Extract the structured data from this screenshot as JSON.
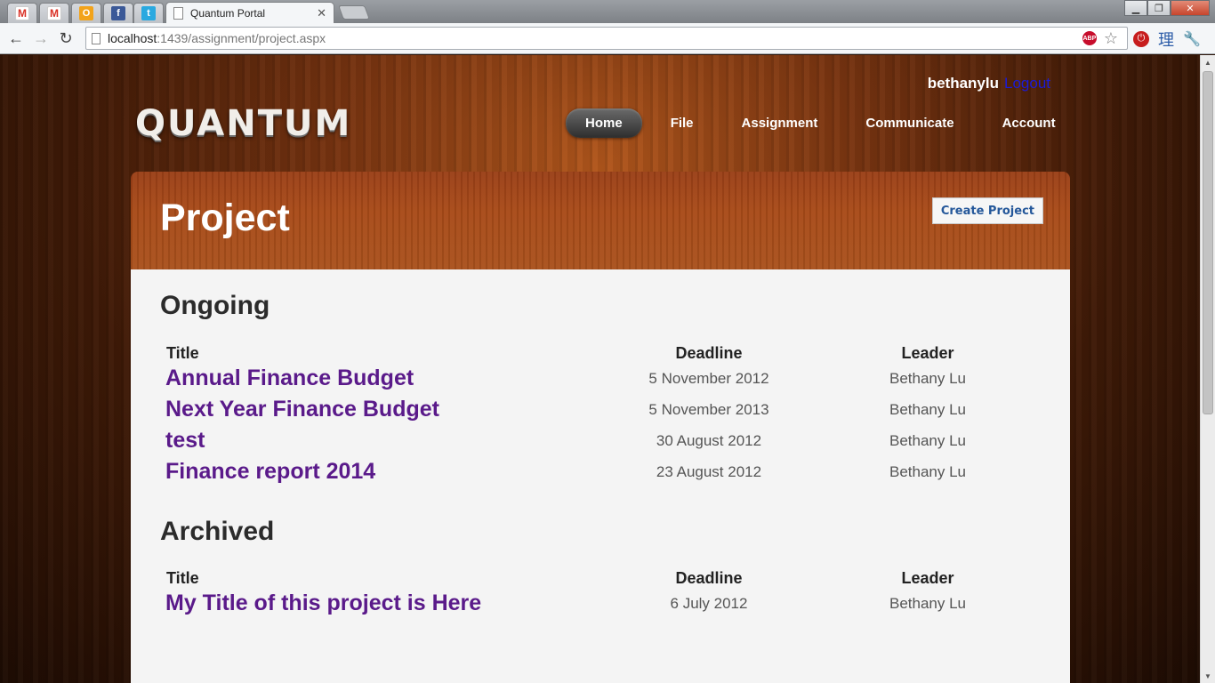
{
  "browser": {
    "pinned_tabs": [
      {
        "icon": "gmail-icon",
        "glyph": "M"
      },
      {
        "icon": "gmail-icon",
        "glyph": "M"
      },
      {
        "icon": "office-icon",
        "glyph": "O"
      },
      {
        "icon": "facebook-icon",
        "glyph": "f"
      },
      {
        "icon": "twitter-icon",
        "glyph": "t"
      }
    ],
    "active_tab_title": "Quantum Portal",
    "url_host": "localhost",
    "url_path": ":1439/assignment/project.aspx",
    "colors": {
      "close_button": "#c7452c",
      "adblock": "#c70d2c"
    }
  },
  "header": {
    "username": "bethanylu",
    "logout_label": "Logout",
    "logo_text": "QUANTUM",
    "nav": [
      "Home",
      "File",
      "Assignment",
      "Communicate",
      "Account"
    ],
    "active_nav": "Home"
  },
  "page": {
    "title": "Project",
    "create_button": "Create Project",
    "columns": {
      "title": "Title",
      "deadline": "Deadline",
      "leader": "Leader"
    },
    "ongoing": {
      "heading": "Ongoing",
      "rows": [
        {
          "title": "Annual Finance Budget",
          "deadline": "5 November 2012",
          "leader": "Bethany Lu"
        },
        {
          "title": "Next Year Finance Budget",
          "deadline": "5 November 2013",
          "leader": "Bethany Lu"
        },
        {
          "title": "test",
          "deadline": "30 August 2012",
          "leader": "Bethany Lu"
        },
        {
          "title": "Finance report 2014",
          "deadline": "23 August 2012",
          "leader": "Bethany Lu"
        }
      ]
    },
    "archived": {
      "heading": "Archived",
      "rows": [
        {
          "title": "My Title of this project is Here",
          "deadline": "6 July 2012",
          "leader": "Bethany Lu"
        }
      ]
    },
    "colors": {
      "link": "#5a1a8a",
      "logout": "#1b1bd8",
      "button_text": "#24579a",
      "panel_body": "#f4f4f4"
    }
  }
}
